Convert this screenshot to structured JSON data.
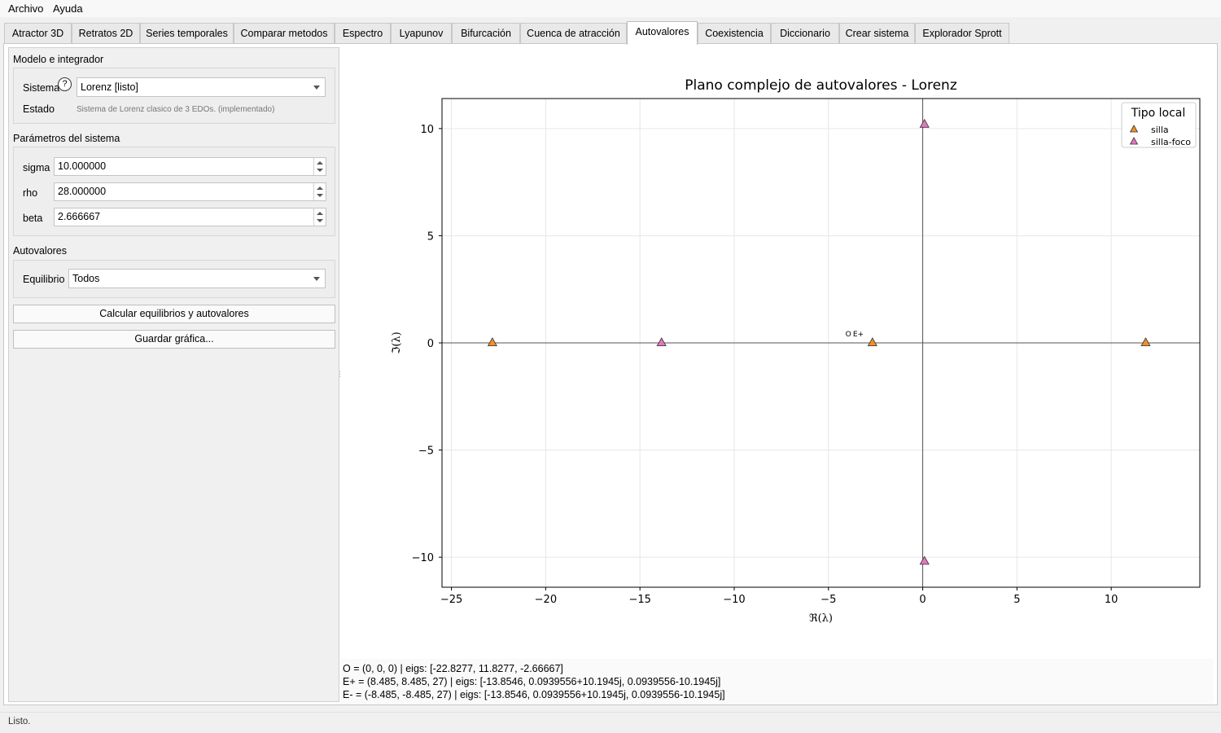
{
  "menu": [
    "Archivo",
    "Ayuda"
  ],
  "tabs": [
    "Atractor 3D",
    "Retratos 2D",
    "Series temporales",
    "Comparar metodos",
    "Espectro",
    "Lyapunov",
    "Bifurcación",
    "Cuenca de atracción",
    "Autovalores",
    "Coexistencia",
    "Diccionario",
    "Crear sistema",
    "Explorador Sprott"
  ],
  "active_tab": "Autovalores",
  "sidebar": {
    "model_section": "Modelo e integrador",
    "system_label": "Sistema",
    "help_glyph": "?",
    "system_value": "Lorenz [listo]",
    "state_label": "Estado",
    "state_value": "Sistema de Lorenz clasico de 3 EDOs. (implementado)",
    "params_section": "Parámetros del sistema",
    "params": [
      {
        "label": "sigma",
        "value": "10.000000"
      },
      {
        "label": "rho",
        "value": "28.000000"
      },
      {
        "label": "beta",
        "value": "2.666667"
      }
    ],
    "eig_section": "Autovalores",
    "equilibrium_label": "Equilibrio",
    "equilibrium_value": "Todos",
    "compute_button": "Calcular equilibrios y autovalores",
    "save_button": "Guardar gráfica..."
  },
  "chart_data": {
    "type": "scatter",
    "title": "Plano complejo de autovalores - Lorenz",
    "xlabel": "ℜ(λ)",
    "ylabel": "ℑ(λ)",
    "xlim": [
      -25.5,
      14.7
    ],
    "ylim": [
      -11.4,
      11.4
    ],
    "xticks": [
      -25,
      -20,
      -15,
      -10,
      -5,
      0,
      5,
      10
    ],
    "yticks": [
      -10,
      -5,
      0,
      5,
      10
    ],
    "grid": true,
    "legend_title": "Tipo local",
    "legend_position": "top-right",
    "series": [
      {
        "name": "silla",
        "color": "#f28e2b",
        "marker": "triangle",
        "points": [
          [
            -22.8277,
            0
          ],
          [
            11.8277,
            0
          ],
          [
            -2.66667,
            0
          ]
        ]
      },
      {
        "name": "silla-foco",
        "color": "#e377c2",
        "marker": "triangle",
        "points": [
          [
            -13.8546,
            0
          ],
          [
            0.0939556,
            10.1945
          ],
          [
            0.0939556,
            -10.1945
          ]
        ]
      }
    ],
    "annotations": [
      {
        "text": "O",
        "x": -4.1,
        "y": 0.45
      },
      {
        "text": "E+",
        "x": -3.7,
        "y": 0.45
      }
    ]
  },
  "info_lines": [
    "O = (0, 0, 0) | eigs: [-22.8277, 11.8277, -2.66667]",
    "E+ = (8.485, 8.485, 27) | eigs: [-13.8546, 0.0939556+10.1945j, 0.0939556-10.1945j]",
    "E- = (-8.485, -8.485, 27) | eigs: [-13.8546, 0.0939556+10.1945j, 0.0939556-10.1945j]"
  ],
  "status": "Listo."
}
